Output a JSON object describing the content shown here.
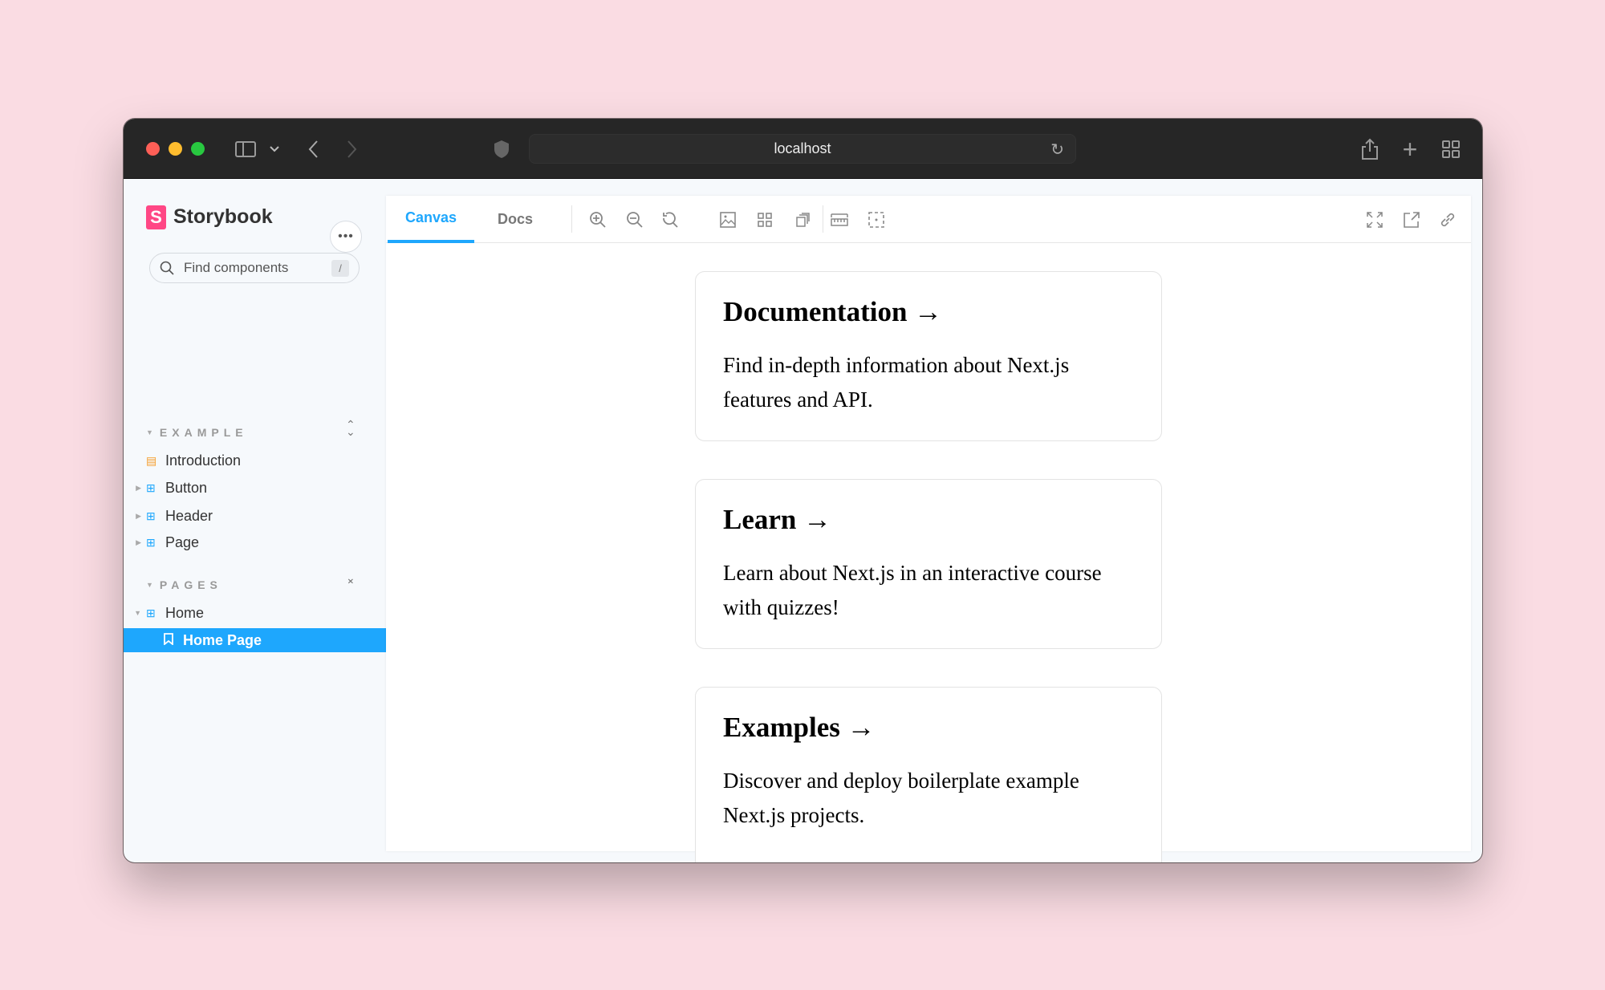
{
  "browser": {
    "url": "localhost"
  },
  "sidebar": {
    "brand": "Storybook",
    "search_placeholder": "Find components",
    "search_shortcut": "/",
    "groups": [
      {
        "label": "EXAMPLE",
        "items": [
          {
            "label": "Introduction",
            "icon": "document-icon"
          },
          {
            "label": "Button",
            "icon": "component-icon"
          },
          {
            "label": "Header",
            "icon": "component-icon"
          },
          {
            "label": "Page",
            "icon": "component-icon"
          }
        ]
      },
      {
        "label": "PAGES",
        "items": [
          {
            "label": "Home",
            "icon": "component-icon"
          },
          {
            "label": "Home Page",
            "icon": "bookmark-icon",
            "selected": true
          }
        ]
      }
    ]
  },
  "toolbar": {
    "tabs": [
      {
        "label": "Canvas",
        "active": true
      },
      {
        "label": "Docs"
      }
    ]
  },
  "cards": [
    {
      "title": "Documentation →",
      "body": "Find in-depth information about Next.js features and API."
    },
    {
      "title": "Learn →",
      "body": "Learn about Next.js in an interactive course with quizzes!"
    },
    {
      "title": "Examples →",
      "body": "Discover and deploy boilerplate example Next.js projects."
    }
  ],
  "colors": {
    "accent": "#1ea7fd",
    "brand": "#ff4785",
    "background": "#fadce3"
  }
}
